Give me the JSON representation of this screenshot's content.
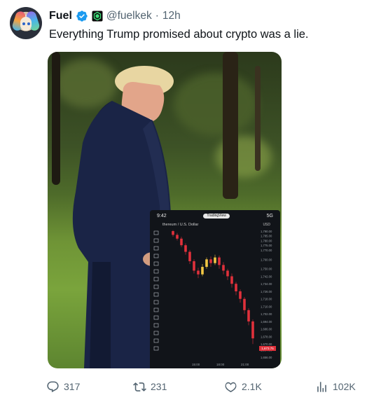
{
  "author": {
    "name": "Fuel",
    "handle": "@fuelkek",
    "separator": "·",
    "time": "12h"
  },
  "tweet": {
    "text": "Everything Trump promised about crypto was a lie."
  },
  "media": {
    "phone": {
      "status_time": "9:42",
      "pill_text": "TradingView",
      "signal_text": "5G",
      "pair_title": "thereum / U.S. Dollar",
      "currency": "USD",
      "price_tag": "1,673.75",
      "price_ticks": [
        "1,790.00",
        "1,785.00",
        "1,780.00",
        "1,775.00",
        "1,770.00",
        "1,760.00",
        "1,750.00",
        "1,742.00",
        "1,734.00",
        "1,726.00",
        "1,718.00",
        "1,710.00",
        "1,702.00",
        "1,694.00",
        "1,686.00",
        "1,678.00",
        "1,670.00",
        "1,664.00",
        "1,656.00"
      ],
      "time_ticks": [
        "15:00",
        "18:00",
        "21:00"
      ],
      "candles": [
        {
          "o": 1790,
          "c": 1786,
          "h": 1791,
          "l": 1784
        },
        {
          "o": 1786,
          "c": 1782,
          "h": 1788,
          "l": 1780
        },
        {
          "o": 1782,
          "c": 1775,
          "h": 1784,
          "l": 1773
        },
        {
          "o": 1775,
          "c": 1768,
          "h": 1777,
          "l": 1765
        },
        {
          "o": 1768,
          "c": 1758,
          "h": 1770,
          "l": 1755
        },
        {
          "o": 1758,
          "c": 1748,
          "h": 1760,
          "l": 1745
        },
        {
          "o": 1748,
          "c": 1744,
          "h": 1751,
          "l": 1740
        },
        {
          "o": 1744,
          "c": 1752,
          "h": 1755,
          "l": 1742
        },
        {
          "o": 1752,
          "c": 1760,
          "h": 1762,
          "l": 1750
        },
        {
          "o": 1760,
          "c": 1756,
          "h": 1763,
          "l": 1752
        },
        {
          "o": 1756,
          "c": 1762,
          "h": 1765,
          "l": 1754
        },
        {
          "o": 1762,
          "c": 1754,
          "h": 1764,
          "l": 1750
        },
        {
          "o": 1754,
          "c": 1748,
          "h": 1757,
          "l": 1744
        },
        {
          "o": 1748,
          "c": 1742,
          "h": 1750,
          "l": 1738
        },
        {
          "o": 1742,
          "c": 1734,
          "h": 1745,
          "l": 1730
        },
        {
          "o": 1734,
          "c": 1726,
          "h": 1736,
          "l": 1722
        },
        {
          "o": 1726,
          "c": 1718,
          "h": 1728,
          "l": 1714
        },
        {
          "o": 1718,
          "c": 1706,
          "h": 1720,
          "l": 1702
        },
        {
          "o": 1706,
          "c": 1694,
          "h": 1708,
          "l": 1690
        },
        {
          "o": 1694,
          "c": 1676,
          "h": 1696,
          "l": 1670
        }
      ]
    }
  },
  "actions": {
    "replies": "317",
    "retweets": "231",
    "likes": "2.1K",
    "views": "102K"
  },
  "colors": {
    "verified": "#1d9bf0",
    "muted": "#536471",
    "text": "#0f1419",
    "candle_up": "#f2c744",
    "candle_down": "#e0313b"
  }
}
